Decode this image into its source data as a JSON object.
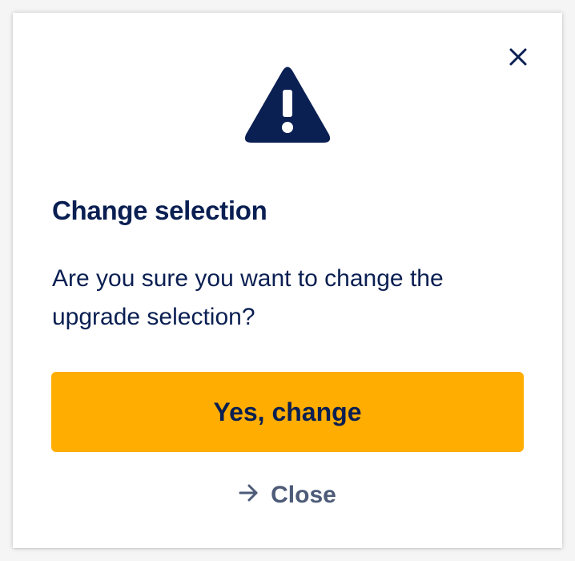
{
  "dialog": {
    "title": "Change selection",
    "message": "Are you sure you want to change the upgrade selection?",
    "primary_label": "Yes, change",
    "secondary_label": "Close",
    "icons": {
      "close": "close-icon",
      "warning": "warning-icon",
      "secondary": "arrow-right-icon"
    }
  },
  "colors": {
    "text_navy": "#0a1f52",
    "primary_button": "#ffad00",
    "secondary_text": "#4d5b78",
    "background": "#ffffff"
  }
}
